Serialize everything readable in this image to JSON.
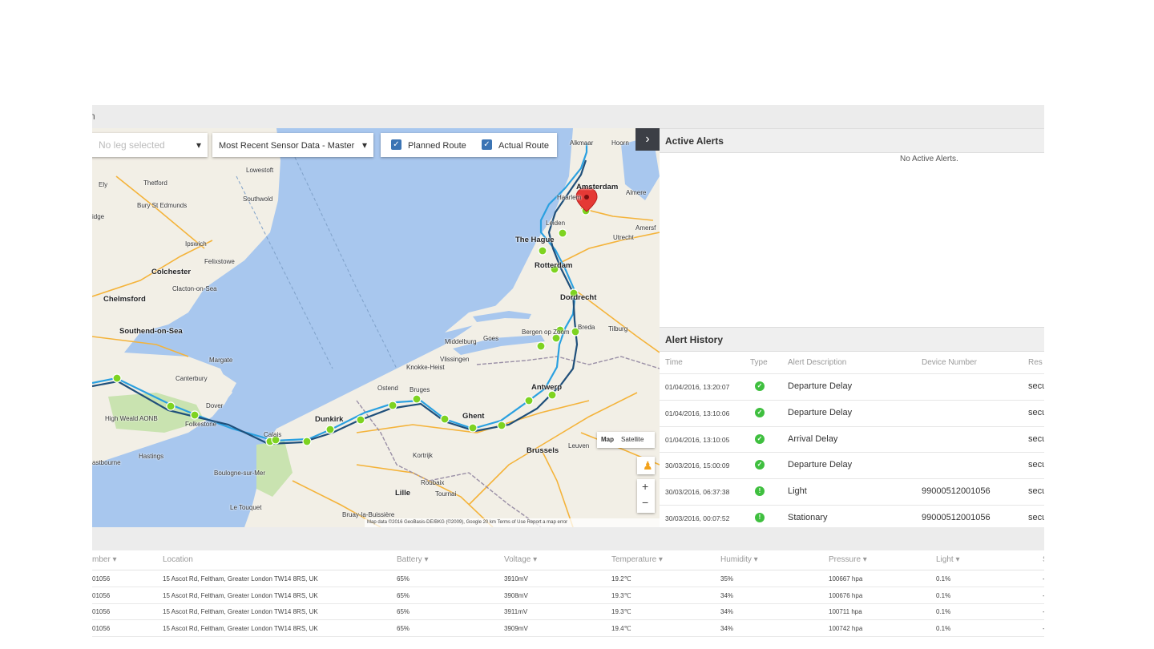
{
  "topbar": {
    "title": "n"
  },
  "map": {
    "leg_select": {
      "value": "No leg selected"
    },
    "data_select": {
      "value": "Most Recent Sensor Data - Master"
    },
    "planned_route": {
      "label": "Planned Route",
      "checked": true
    },
    "actual_route": {
      "label": "Actual Route",
      "checked": true
    },
    "expand_icon": "chevron-right-icon",
    "map_type": {
      "map": "Map",
      "satellite": "Satellite"
    },
    "zoom": {
      "in": "+",
      "out": "−"
    },
    "footer": "Map data ©2016 GeoBasis-DE/BKG (©2009), Google   20 km   Terms of Use   Report a map error",
    "labels": {
      "lowestoft": "Lowestoft",
      "thetford": "Thetford",
      "southwold": "Southwold",
      "ely": "Ely",
      "bury": "Bury St Edmunds",
      "ipswich": "Ipswich",
      "felixstowe": "Felixstowe",
      "colchester": "Colchester",
      "clacton": "Clacton-on-Sea",
      "chelmsford": "Chelmsford",
      "southend": "Southend-on-Sea",
      "margate": "Margate",
      "canterbury": "Canterbury",
      "dover": "Dover",
      "folkestone": "Folkestone",
      "hastings": "Hastings",
      "eastbourne": "astbourne",
      "boulogne": "Boulogne-sur-Mer",
      "letouquet": "Le Touquet",
      "calais": "Calais",
      "dunkirk": "Dunkirk",
      "ostend": "Ostend",
      "bruges": "Bruges",
      "knokke": "Knokke-Heist",
      "vlissingen": "Vlissingen",
      "middelburg": "Middelburg",
      "goes": "Goes",
      "ghent": "Ghent",
      "antwerp": "Antwerp",
      "brussels": "Brussels",
      "leuven": "Leuven",
      "kortrijk": "Kortrijk",
      "lille": "Lille",
      "roubaix": "Roubaix",
      "tournai": "Tournai",
      "bruay": "Bruay-la-Buissière",
      "bergen": "Bergen op Zoom",
      "breda": "Breda",
      "tilburg": "Tilburg",
      "dordrecht": "Dordrecht",
      "rotterdam": "Rotterdam",
      "thehague": "The Hague",
      "leiden": "Leiden",
      "haarlem": "Haarlem",
      "amsterdam": "Amsterdam",
      "almere": "Almere",
      "utrecht": "Utrecht",
      "alkmaar": "Alkmaar",
      "hoorn": "Hoorn",
      "amersfoort": "Amersf",
      "highweald": "High Weald AONB",
      "ridge": "idge"
    }
  },
  "alerts": {
    "active_title": "Active Alerts",
    "no_alerts": "No Active Alerts.",
    "history_title": "Alert History",
    "columns": [
      "Time",
      "Type",
      "Alert Description",
      "Device Number",
      "Res"
    ],
    "rows": [
      {
        "time": "01/04/2016, 13:20:07",
        "type": "ok",
        "description": "Departure Delay",
        "device": "",
        "res": "secu"
      },
      {
        "time": "01/04/2016, 13:10:06",
        "type": "ok",
        "description": "Departure Delay",
        "device": "",
        "res": "secu"
      },
      {
        "time": "01/04/2016, 13:10:05",
        "type": "ok",
        "description": "Arrival Delay",
        "device": "",
        "res": "secu"
      },
      {
        "time": "30/03/2016, 15:00:09",
        "type": "ok",
        "description": "Departure Delay",
        "device": "",
        "res": "secu"
      },
      {
        "time": "30/03/2016, 06:37:38",
        "type": "warn",
        "description": "Light",
        "device": "99000512001056",
        "res": "secu"
      },
      {
        "time": "30/03/2016, 00:07:52",
        "type": "warn",
        "description": "Stationary",
        "device": "99000512001056",
        "res": "secu"
      }
    ]
  },
  "sensor_table": {
    "columns": [
      "mber ▾",
      "Location",
      "Battery ▾",
      "Voltage ▾",
      "Temperature ▾",
      "Humidity ▾",
      "Pressure ▾",
      "Light ▾",
      "S"
    ],
    "rows": [
      {
        "number": "01056",
        "location": "15 Ascot Rd, Feltham, Greater London TW14 8RS, UK",
        "battery": "65%",
        "voltage": "3910mV",
        "temperature": "19.2℃",
        "humidity": "35%",
        "pressure": "100667 hpa",
        "light": "0.1%",
        "s": "-"
      },
      {
        "number": "01056",
        "location": "15 Ascot Rd, Feltham, Greater London TW14 8RS, UK",
        "battery": "65%",
        "voltage": "3908mV",
        "temperature": "19.3℃",
        "humidity": "34%",
        "pressure": "100676 hpa",
        "light": "0.1%",
        "s": "-"
      },
      {
        "number": "01056",
        "location": "15 Ascot Rd, Feltham, Greater London TW14 8RS, UK",
        "battery": "65%",
        "voltage": "3911mV",
        "temperature": "19.3℃",
        "humidity": "34%",
        "pressure": "100711 hpa",
        "light": "0.1%",
        "s": "-"
      },
      {
        "number": "01056",
        "location": "15 Ascot Rd, Feltham, Greater London TW14 8RS, UK",
        "battery": "65%",
        "voltage": "3909mV",
        "temperature": "19.4℃",
        "humidity": "34%",
        "pressure": "100742 hpa",
        "light": "0.1%",
        "s": "-"
      }
    ]
  },
  "colors": {
    "route_planned": "#2aa0e0",
    "route_actual": "#1f4f7a",
    "waypoint": "#7ed321",
    "ok": "#3fbf3f",
    "sea": "#a8c7ee",
    "land": "#f2efe6"
  }
}
